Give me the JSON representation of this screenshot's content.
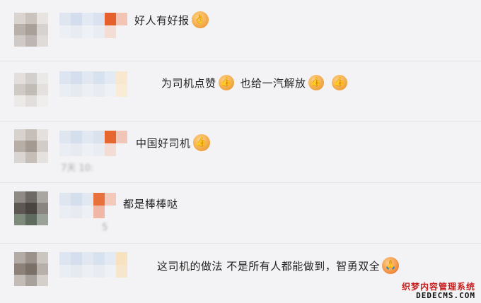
{
  "comments": [
    {
      "text": "好人有好报",
      "emojis": [
        "ok-hand-icon"
      ],
      "meta": ""
    },
    {
      "text_a": "为司机点赞",
      "text_b": "也给一汽解放",
      "emojis": [
        "thumbs-up-icon",
        "thumbs-up-icon",
        "thumbs-up-icon"
      ],
      "meta": ""
    },
    {
      "text": "中国好司机",
      "emojis": [
        "thumbs-up-icon"
      ],
      "meta": "7天 10:"
    },
    {
      "text": "都是棒棒哒",
      "emojis": [],
      "meta": "5"
    },
    {
      "text": "这司机的做法 不是所有人都能做到，智勇双全",
      "emojis": [
        "fist-salute-icon"
      ],
      "meta": ""
    }
  ],
  "icons": {
    "ok_hand": "👌",
    "thumbs_up": "👍",
    "fist_salute": "🙏"
  },
  "watermark": {
    "cn": "织梦内容管理系统",
    "en": "DEDECMS.COM"
  },
  "colors": {
    "background": "#f3f3f5",
    "divider": "#e5e5e8",
    "text": "#222222",
    "watermark_red": "#c81d1d"
  }
}
